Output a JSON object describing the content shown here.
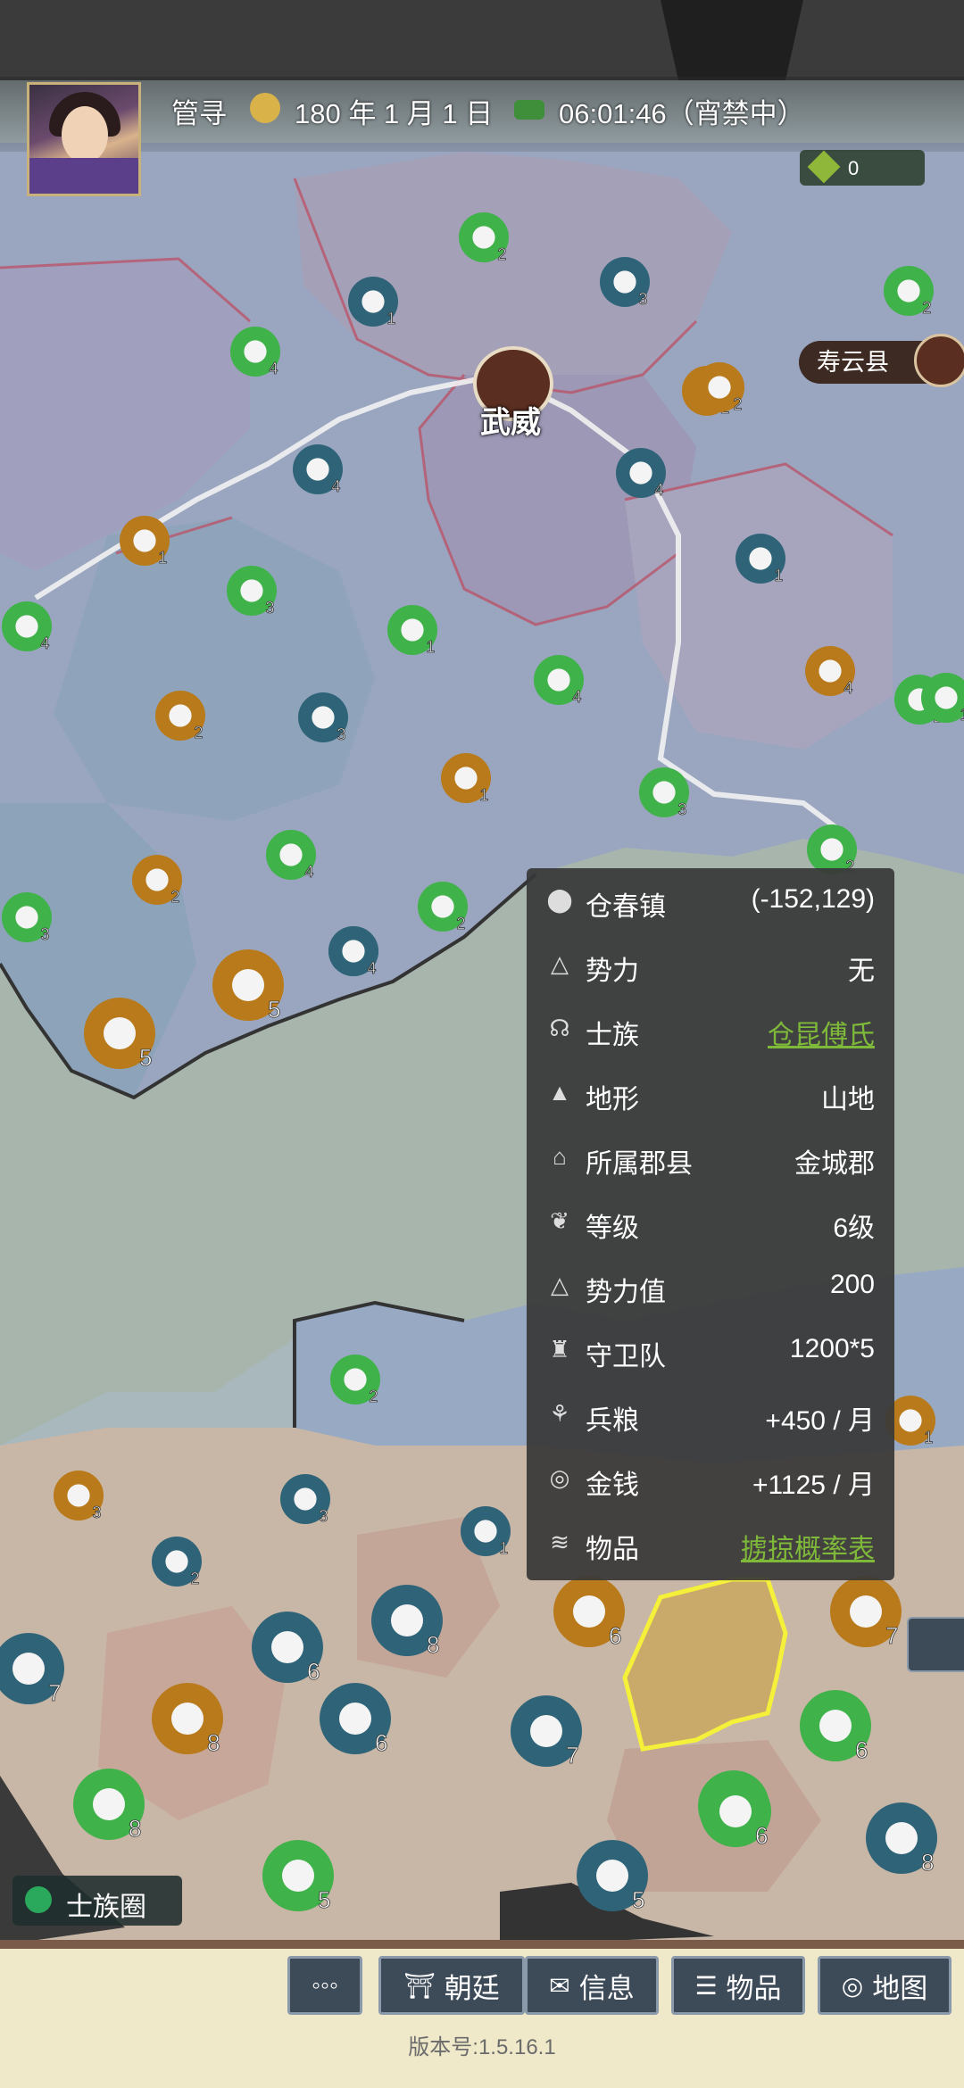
{
  "header": {
    "player_name": "管寻",
    "date": "180 年 1 月 1 日",
    "time": "06:01:46（宵禁中）",
    "resource_count": "0"
  },
  "map": {
    "capital_label": "武威",
    "county_label": "寿云县",
    "colors": {
      "water": "#9aaab2",
      "grass": "#3fb24a",
      "coin": "#2f6478",
      "book": "#b87a1a",
      "brown": "#5a2e20"
    },
    "markers": [
      {
        "type": "coin",
        "n": "1"
      },
      {
        "type": "grain",
        "n": "4"
      },
      {
        "type": "herb",
        "n": "2"
      },
      {
        "type": "coin",
        "n": "3"
      },
      {
        "type": "coin",
        "n": "4"
      },
      {
        "type": "book",
        "n": "2"
      },
      {
        "type": "coin",
        "n": "4"
      },
      {
        "type": "book",
        "n": "1"
      },
      {
        "type": "grain",
        "n": "3"
      },
      {
        "type": "herb",
        "n": "1"
      },
      {
        "type": "grain",
        "n": "4"
      },
      {
        "type": "grain",
        "n": "4"
      },
      {
        "type": "book",
        "n": "2"
      },
      {
        "type": "coin",
        "n": "3"
      },
      {
        "type": "book",
        "n": "1"
      },
      {
        "type": "grain",
        "n": "3"
      },
      {
        "type": "herb",
        "n": "2"
      },
      {
        "type": "coin",
        "n": "4"
      },
      {
        "type": "grain",
        "n": "4"
      },
      {
        "type": "book",
        "n": "2"
      },
      {
        "type": "herb",
        "n": "2"
      },
      {
        "type": "grain",
        "n": "3"
      },
      {
        "type": "cloth",
        "n": "5"
      },
      {
        "type": "coin",
        "n": "4"
      },
      {
        "type": "cloth",
        "n": "5"
      },
      {
        "type": "book",
        "n": "4"
      },
      {
        "type": "coin",
        "n": "1"
      },
      {
        "type": "herb",
        "n": "2"
      },
      {
        "type": "herb",
        "n": "1"
      },
      {
        "type": "book",
        "n": "2"
      },
      {
        "type": "herb",
        "n": "2"
      },
      {
        "type": "book",
        "n": "3"
      },
      {
        "type": "coin",
        "n": "3"
      },
      {
        "type": "coin",
        "n": "2"
      },
      {
        "type": "coin",
        "n": "1"
      },
      {
        "type": "gem",
        "n": "8"
      },
      {
        "type": "cloth",
        "n": "6"
      },
      {
        "type": "coins",
        "n": "6"
      },
      {
        "type": "coins",
        "n": "7"
      },
      {
        "type": "scroll",
        "n": "8"
      },
      {
        "type": "coins",
        "n": "6"
      },
      {
        "type": "coins",
        "n": "7"
      },
      {
        "type": "cloth",
        "n": "7"
      },
      {
        "type": "grain",
        "n": "6"
      },
      {
        "type": "grain",
        "n": "7"
      },
      {
        "type": "bag",
        "n": "8"
      },
      {
        "type": "grain",
        "n": "5"
      },
      {
        "type": "coins",
        "n": "5"
      },
      {
        "type": "grain",
        "n": "6"
      },
      {
        "type": "gem",
        "n": "8"
      },
      {
        "type": "book",
        "n": "1"
      },
      {
        "type": "herb",
        "n": "2"
      }
    ]
  },
  "info_panel": {
    "rows": [
      {
        "icon": "location-icon",
        "label": "仓春镇",
        "value": "(-152,129)",
        "link": false
      },
      {
        "icon": "power-icon",
        "label": "势力",
        "value": "无",
        "link": false
      },
      {
        "icon": "clan-icon",
        "label": "士族",
        "value": "仓昆傅氏",
        "link": true
      },
      {
        "icon": "terrain-icon",
        "label": "地形",
        "value": "山地",
        "link": false
      },
      {
        "icon": "county-icon",
        "label": "所属郡县",
        "value": "金城郡",
        "link": false
      },
      {
        "icon": "level-icon",
        "label": "等级",
        "value": "6级",
        "link": false
      },
      {
        "icon": "power-value-icon",
        "label": "势力值",
        "value": "200",
        "link": false
      },
      {
        "icon": "guard-icon",
        "label": "守卫队",
        "value": "1200*5",
        "link": false
      },
      {
        "icon": "grain-icon",
        "label": "兵粮",
        "value": "+450 / 月",
        "link": false
      },
      {
        "icon": "money-icon",
        "label": "金钱",
        "value": "+1125 / 月",
        "link": false
      },
      {
        "icon": "items-icon",
        "label": "物品",
        "value": "掳掠概率表",
        "link": true
      }
    ]
  },
  "clan_circle": "士族圈",
  "bottom_buttons": [
    {
      "label": "",
      "icon": "more-icon",
      "glyph": "◦◦◦"
    },
    {
      "label": "朝廷",
      "icon": "court-icon",
      "glyph": "⛩"
    },
    {
      "label": "信息",
      "icon": "message-icon",
      "glyph": "✉"
    },
    {
      "label": "物品",
      "icon": "items-icon",
      "glyph": "☰"
    },
    {
      "label": "地图",
      "icon": "map-icon",
      "glyph": "◎"
    }
  ],
  "version": "版本号:1.5.16.1"
}
